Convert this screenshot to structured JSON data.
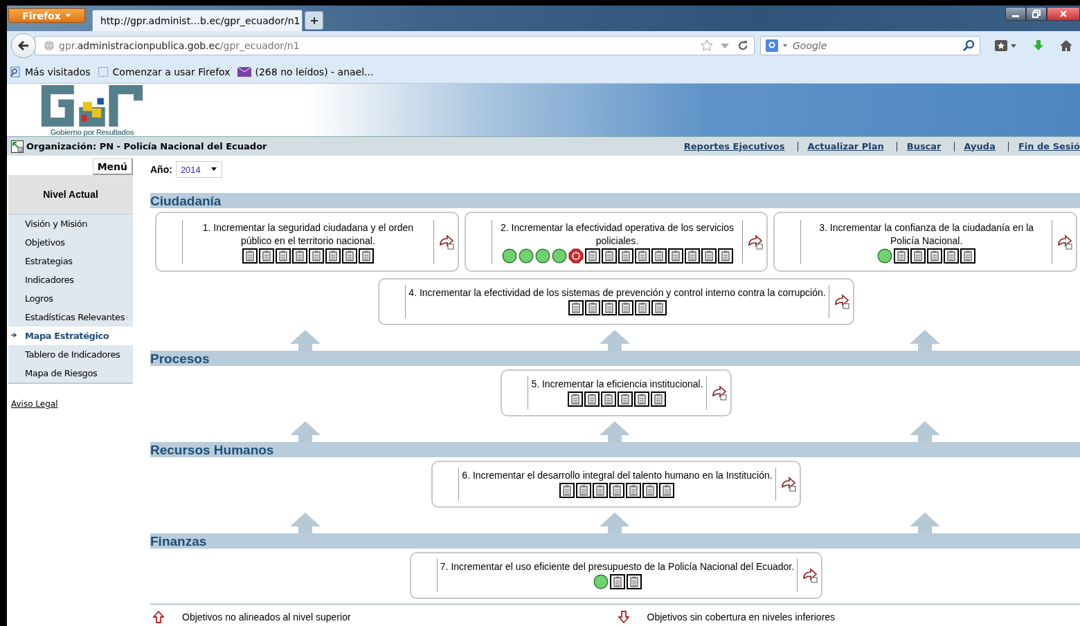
{
  "browser": {
    "menu_button": "Firefox",
    "tab_title": "http://gpr.administ…b.ec/gpr_ecuador/n1",
    "url": {
      "prefix": "gpr.",
      "domain": "administracionpublica.gob.ec",
      "path": "/gpr_ecuador/n1"
    },
    "search": {
      "placeholder": "Google"
    },
    "bookmarks": [
      {
        "label": "Más visitados",
        "kind": "folder"
      },
      {
        "label": "Comenzar a usar Firefox",
        "kind": "page"
      },
      {
        "label": "(268 no leídos) - anael...",
        "kind": "mail"
      }
    ]
  },
  "header": {
    "logo_caption": "Gobierno por Resultados",
    "organization": "Organización: PN - Policía Nacional del Ecuador",
    "links": [
      "Reportes Ejecutivos",
      "Actualizar Plan",
      "Buscar",
      "Ayuda",
      "Fin de Sesió"
    ]
  },
  "sidebar": {
    "menu_button": "Menú",
    "heading": "Nivel Actual",
    "items": [
      {
        "label": "Visión y Misión",
        "selected": false
      },
      {
        "label": "Objetivos",
        "selected": false
      },
      {
        "label": "Estrategias",
        "selected": false
      },
      {
        "label": "Indicadores",
        "selected": false
      },
      {
        "label": "Logros",
        "selected": false
      },
      {
        "label": "Estadísticas Relevantes",
        "selected": false
      },
      {
        "label": "Mapa Estratégico",
        "selected": true
      },
      {
        "label": "Tablero de Indicadores",
        "selected": false
      },
      {
        "label": "Mapa de Riesgos",
        "selected": false
      }
    ],
    "footer_link": "Aviso Legal"
  },
  "year": {
    "label": "Año:",
    "value": "2014"
  },
  "perspectives": [
    {
      "title": "Ciudadanía",
      "objectives": [
        {
          "text": "1. Incrementar la seguridad ciudadana y el orden público en el territorio nacional.",
          "indicators": [
            {
              "kind": "doc"
            },
            {
              "kind": "doc"
            },
            {
              "kind": "doc"
            },
            {
              "kind": "doc"
            },
            {
              "kind": "doc"
            },
            {
              "kind": "doc"
            },
            {
              "kind": "doc"
            },
            {
              "kind": "doc"
            }
          ]
        },
        {
          "text": "2. Incrementar la efectividad operativa de los servicios policiales.",
          "indicators": [
            {
              "kind": "ok"
            },
            {
              "kind": "ok"
            },
            {
              "kind": "ok"
            },
            {
              "kind": "ok"
            },
            {
              "kind": "alert"
            },
            {
              "kind": "doc"
            },
            {
              "kind": "doc"
            },
            {
              "kind": "doc"
            },
            {
              "kind": "doc"
            },
            {
              "kind": "doc"
            },
            {
              "kind": "doc"
            },
            {
              "kind": "doc"
            },
            {
              "kind": "doc"
            },
            {
              "kind": "doc"
            }
          ]
        },
        {
          "text": "3. Incrementar la confianza de la ciudadanía en la Policía Nacional.",
          "indicators": [
            {
              "kind": "ok"
            },
            {
              "kind": "doc"
            },
            {
              "kind": "doc"
            },
            {
              "kind": "doc"
            },
            {
              "kind": "doc"
            },
            {
              "kind": "doc"
            }
          ]
        },
        {
          "text": "4. Incrementar la efectividad de los sistemas de prevención y control interno contra la corrupción.",
          "indicators": [
            {
              "kind": "doc"
            },
            {
              "kind": "doc"
            },
            {
              "kind": "doc"
            },
            {
              "kind": "doc"
            },
            {
              "kind": "doc"
            },
            {
              "kind": "doc"
            }
          ]
        }
      ]
    },
    {
      "title": "Procesos",
      "objectives": [
        {
          "text": "5. Incrementar la eficiencia institucional.",
          "indicators": [
            {
              "kind": "doc"
            },
            {
              "kind": "doc"
            },
            {
              "kind": "doc"
            },
            {
              "kind": "doc"
            },
            {
              "kind": "doc"
            },
            {
              "kind": "doc"
            }
          ]
        }
      ]
    },
    {
      "title": "Recursos Humanos",
      "objectives": [
        {
          "text": "6. Incrementar el desarrollo integral del talento humano en la Institución.",
          "indicators": [
            {
              "kind": "doc"
            },
            {
              "kind": "doc"
            },
            {
              "kind": "doc"
            },
            {
              "kind": "doc"
            },
            {
              "kind": "doc"
            },
            {
              "kind": "doc"
            },
            {
              "kind": "doc"
            }
          ]
        }
      ]
    },
    {
      "title": "Finanzas",
      "objectives": [
        {
          "text": "7. Incrementar el uso eficiente del presupuesto de la Policía Nacional del Ecuador.",
          "indicators": [
            {
              "kind": "ok"
            },
            {
              "kind": "doc"
            },
            {
              "kind": "doc"
            }
          ]
        }
      ]
    }
  ],
  "legend": [
    {
      "text": "Objetivos no alineados al nivel superior",
      "kind": "up"
    },
    {
      "text": "Objetivos sin cobertura en niveles inferiores",
      "kind": "down"
    }
  ]
}
